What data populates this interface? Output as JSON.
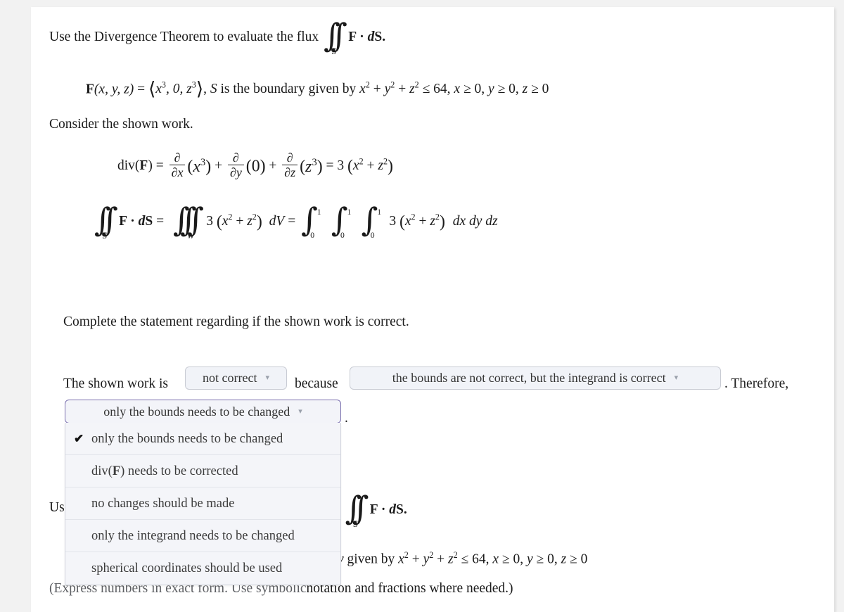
{
  "page": {
    "background": "#f2f2f2",
    "card_background": "#ffffff"
  },
  "question": {
    "prompt_lead": "Use the Divergence Theorem to evaluate the flux",
    "prompt_integral_sub": "S",
    "prompt_integral_body": "F · dS.",
    "field_label": "F",
    "field_args": "(x, y, z)",
    "field_value": "x³, 0, z³",
    "boundary_text": ", S is the boundary given by x² + y² + z² ≤ 64, x ≥ 0, y ≥ 0, z ≥ 0",
    "consider_line": "Consider the shown work.",
    "complete_line": "Complete the statement regarding if the shown work is correct.",
    "instruction_note": "(Express numbers in exact form. Use symbolic notation and fractions where needed.)",
    "instruction_note_visible_tail": "notation and fractions where needed.)",
    "instruction_note_faded_head": "(Express numbers in exact form. Use symbolic"
  },
  "work": {
    "div_label": "div(F)",
    "div_eq": "=",
    "div_term1_num": "∂",
    "div_term1_den": "∂x",
    "div_term1_arg": "x³",
    "div_term2_num": "∂",
    "div_term2_den": "∂y",
    "div_term2_arg": "0",
    "div_term3_num": "∂",
    "div_term3_den": "∂z",
    "div_term3_arg": "z³",
    "div_result": "3 (x² + z²)",
    "flux_lhs_sub": "S",
    "flux_lhs": "F · dS",
    "triple_sub": "W",
    "triple_integrand": "3 (x² + z²)",
    "dV": "dV",
    "limits_lower": "0",
    "limits_upper": "1",
    "final_integrand": "3 (x² + z²)",
    "final_differentials": "dx dy dz"
  },
  "statement": {
    "lead": "The shown work is",
    "connector": "because",
    "tail": ". Therefore,",
    "period": "."
  },
  "dropdowns": {
    "work_correctness": {
      "name": "work-correctness-dropdown",
      "value": "not correct",
      "caret": "▾",
      "open": false
    },
    "reason": {
      "name": "reason-dropdown",
      "value": "the bounds are not correct, but the integrand is correct",
      "caret": "▾",
      "open": false
    },
    "change_needed": {
      "name": "change-needed-dropdown",
      "value": "only the bounds needs to be changed",
      "caret": "▾",
      "open": true,
      "focus_border_color": "#7a6fae",
      "selected_index": 0,
      "checkmark": "✔",
      "options": [
        "only the bounds needs to be changed",
        "div(F) needs to be corrected",
        "no changes should be made",
        "only the integrand needs to be changed",
        "spherical coordinates should be used"
      ]
    }
  },
  "obscured_repeat": {
    "line1_head": "Us",
    "line1_tail_int_sub": "S",
    "line1_tail": "F · dS.",
    "line2_tail": "y given by x² + y² + z² ≤ 64, x ≥ 0, y ≥ 0, z ≥ 0"
  }
}
